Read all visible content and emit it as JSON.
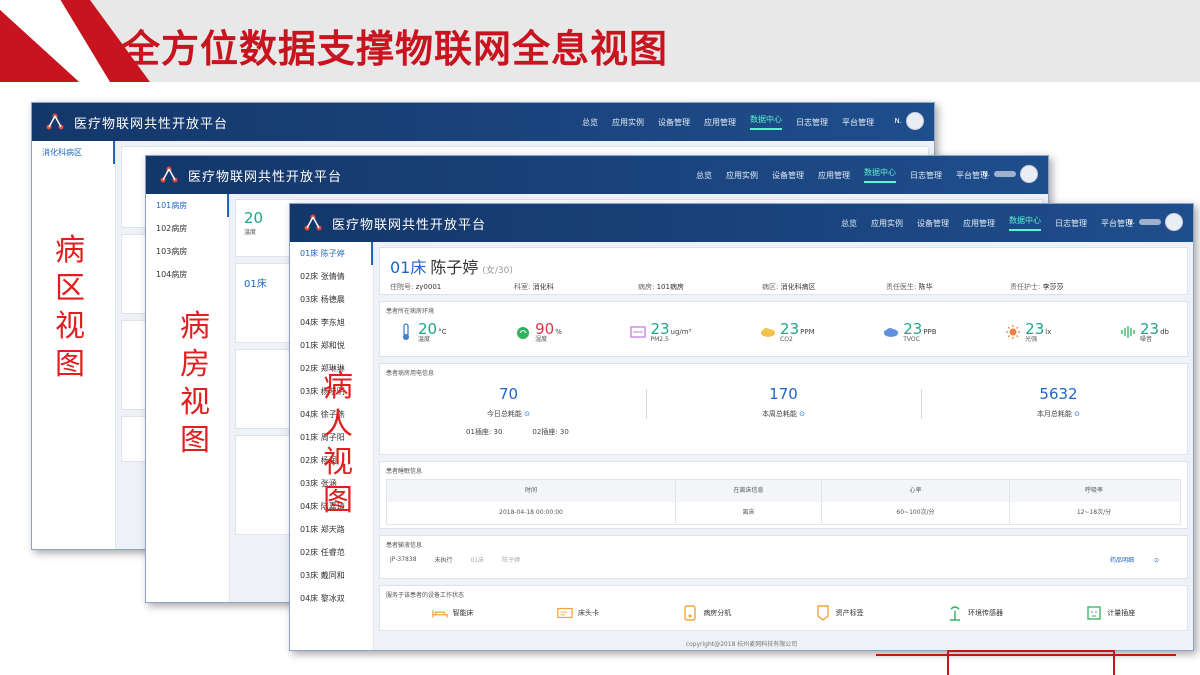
{
  "slide": {
    "title": "全方位数据支撑物联网全息视图",
    "labels": {
      "ward": "病区视图",
      "room": "病房视图",
      "patient": "病人视图"
    }
  },
  "colors": {
    "accent_red": "#c8141e",
    "nav_blue": "#14376a",
    "link_blue": "#1f66c1",
    "teal": "#1fa58a"
  },
  "nav": {
    "brand": "医疗物联网共性开放平台",
    "items": [
      "总览",
      "应用实例",
      "设备管理",
      "应用管理",
      "数据中心",
      "日志管理",
      "平台管理"
    ],
    "active": "数据中心",
    "user_initial": "N."
  },
  "window1": {
    "sidebar": [
      "消化科病区"
    ]
  },
  "window2": {
    "sidebar": [
      "101病房",
      "102病房",
      "103病房",
      "104病房"
    ],
    "env_value": "20",
    "env_label": "温度",
    "bed_label": "01床"
  },
  "window3": {
    "sidebar": [
      "01床 陈子婷",
      "02床 张倩倩",
      "03床 杨德晨",
      "04床 李东旭",
      "01床 郑和悦",
      "02床 郑琳琳",
      "03床 杨晓明",
      "04床 徐子燕",
      "01床 周子阳",
      "02床 杨润",
      "03床 张涵",
      "04床 陆嘉琦",
      "01床 郑天路",
      "02床 任睿范",
      "03床 戴同和",
      "04床 黎冰双"
    ],
    "patient": {
      "bed": "01床",
      "name": "陈子婷",
      "meta": "(女/30)",
      "fields": [
        {
          "label": "住院号:",
          "value": "zy0001"
        },
        {
          "label": "科室:",
          "value": "消化科"
        },
        {
          "label": "病房:",
          "value": "101病房"
        },
        {
          "label": "病区:",
          "value": "消化科病区"
        },
        {
          "label": "责任医生:",
          "value": "陈华"
        },
        {
          "label": "责任护士:",
          "value": "李莎莎"
        }
      ]
    },
    "env": {
      "header": "患者所在病房环境",
      "items": [
        {
          "icon": "thermometer-icon",
          "value": "20",
          "unit": "°C",
          "label": "温度"
        },
        {
          "icon": "humidity-icon",
          "value": "90",
          "unit": "%",
          "label": "湿度"
        },
        {
          "icon": "pm25-icon",
          "value": "23",
          "unit": "ug/m³",
          "label": "PM2.5"
        },
        {
          "icon": "co2-icon",
          "value": "23",
          "unit": "PPM",
          "label": "CO2"
        },
        {
          "icon": "tvoc-icon",
          "value": "23",
          "unit": "PPB",
          "label": "TVOC"
        },
        {
          "icon": "sun-icon",
          "value": "23",
          "unit": "lx",
          "label": "光强"
        },
        {
          "icon": "noise-icon",
          "value": "23",
          "unit": "db",
          "label": "噪音"
        }
      ]
    },
    "power": {
      "header": "患者病房用电信息",
      "items": [
        {
          "value": "70",
          "label": "今日总耗能"
        },
        {
          "value": "170",
          "label": "本周总耗能"
        },
        {
          "value": "5632",
          "label": "本月总耗能"
        }
      ],
      "plugs": [
        "01插座: 30",
        "02插座: 30"
      ]
    },
    "sleep": {
      "header": "患者睡眠信息",
      "columns": [
        "时间",
        "在离床信息",
        "心率",
        "呼吸率"
      ],
      "rows": [
        [
          "2018-04-18 00:00:00",
          "离床",
          "60~100次/分",
          "12~18次/分"
        ]
      ]
    },
    "infusion": {
      "header": "患者输液信息",
      "cells": [
        "JP-37838",
        "未执行",
        "01床",
        "陈子婷"
      ],
      "link": "药品明细"
    },
    "devices": {
      "header": "服务于该患者的设备工作状态",
      "items": [
        {
          "icon": "smart-bed-icon",
          "label": "智能床"
        },
        {
          "icon": "bed-card-icon",
          "label": "床头卡"
        },
        {
          "icon": "ward-extension-icon",
          "label": "病房分机"
        },
        {
          "icon": "asset-tag-icon",
          "label": "资产标签"
        },
        {
          "icon": "env-sensor-icon",
          "label": "环境传感器"
        },
        {
          "icon": "metering-socket-icon",
          "label": "计量插座"
        }
      ]
    },
    "copyright": "copyright@2018 杭州麦网科技有限公司"
  }
}
